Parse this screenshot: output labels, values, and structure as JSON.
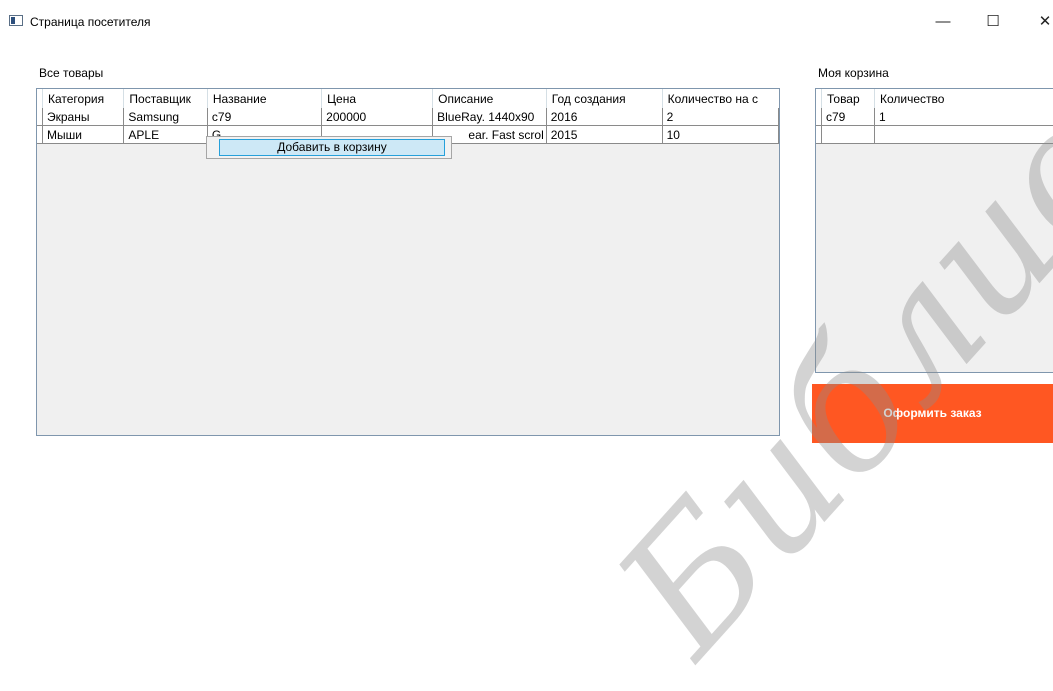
{
  "window": {
    "title": "Страница посетителя",
    "minimize_glyph": "—",
    "maximize_glyph": "☐",
    "close_glyph": "✕"
  },
  "products": {
    "label": "Все товары",
    "columns": [
      "Категория",
      "Поставщик",
      "Название",
      "Цена",
      "Описание",
      "Год создания",
      "Количество на с"
    ],
    "rows": [
      [
        "Экраны",
        "Samsung",
        "c79",
        "200000",
        "BlueRay. 1440x90",
        "2016",
        "2"
      ],
      [
        "Мыши",
        "APLE",
        "G",
        "",
        "ear. Fast scrol",
        "2015",
        "10"
      ]
    ]
  },
  "context_menu": {
    "add_to_cart": "Добавить в корзину"
  },
  "cart": {
    "label": "Моя корзина",
    "columns": [
      "Товар",
      "Количество"
    ],
    "rows": [
      [
        "c79",
        "1"
      ],
      [
        "",
        ""
      ]
    ]
  },
  "order_button": "Оформить заказ",
  "watermark": "Библиотека БГ"
}
